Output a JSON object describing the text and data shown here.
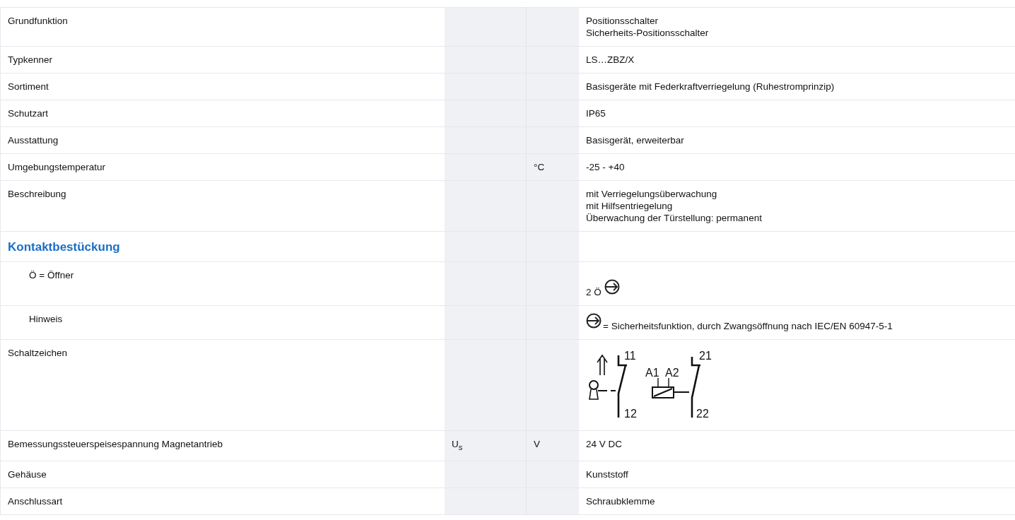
{
  "rows": [
    {
      "kind": "text",
      "label": "Grundfunktion",
      "value": [
        "Positionsschalter",
        "Sicherheits-Positionsschalter"
      ]
    },
    {
      "kind": "text",
      "label": "Typkenner",
      "value": [
        "LS…ZBZ/X"
      ]
    },
    {
      "kind": "text",
      "label": "Sortiment",
      "value": [
        "Basisgeräte mit Federkraftverriegelung (Ruhestromprinzip)"
      ]
    },
    {
      "kind": "text",
      "label": "Schutzart",
      "value": [
        "IP65"
      ]
    },
    {
      "kind": "text",
      "label": "Ausstattung",
      "value": [
        "Basisgerät, erweiterbar"
      ]
    },
    {
      "kind": "text",
      "label": "Umgebungstemperatur",
      "unit": "°C",
      "value": [
        "-25 - +40"
      ]
    },
    {
      "kind": "text",
      "label": "Beschreibung",
      "value": [
        "mit Verriegelungsüberwachung",
        "mit Hilfsentriegelung",
        "Überwachung der Türstellung: permanent"
      ]
    },
    {
      "kind": "heading",
      "title": "Kontaktbestückung",
      "children": [
        {
          "kind": "text_then_icon",
          "label": "Ö = Öffner",
          "value": [
            "2 Ö"
          ]
        },
        {
          "kind": "icon_then_text",
          "label": "Hinweis",
          "value": [
            "= Sicherheitsfunktion, durch Zwangsöffnung nach IEC/EN 60947-5-1"
          ]
        }
      ]
    },
    {
      "kind": "diagram",
      "label": "Schaltzeichen",
      "terminals": [
        "11",
        "12",
        "A1",
        "A2",
        "21",
        "22"
      ]
    },
    {
      "kind": "text",
      "label": "Bemessungssteuerspeisespannung Magnetantrieb",
      "symbol": "U$_{s}$",
      "unit": "V",
      "value": [
        "24 V DC"
      ]
    },
    {
      "kind": "text",
      "label": "Gehäuse",
      "value": [
        "Kunststoff"
      ]
    },
    {
      "kind": "text",
      "label": "Anschlussart",
      "value": [
        "Schraubklemme"
      ]
    }
  ]
}
